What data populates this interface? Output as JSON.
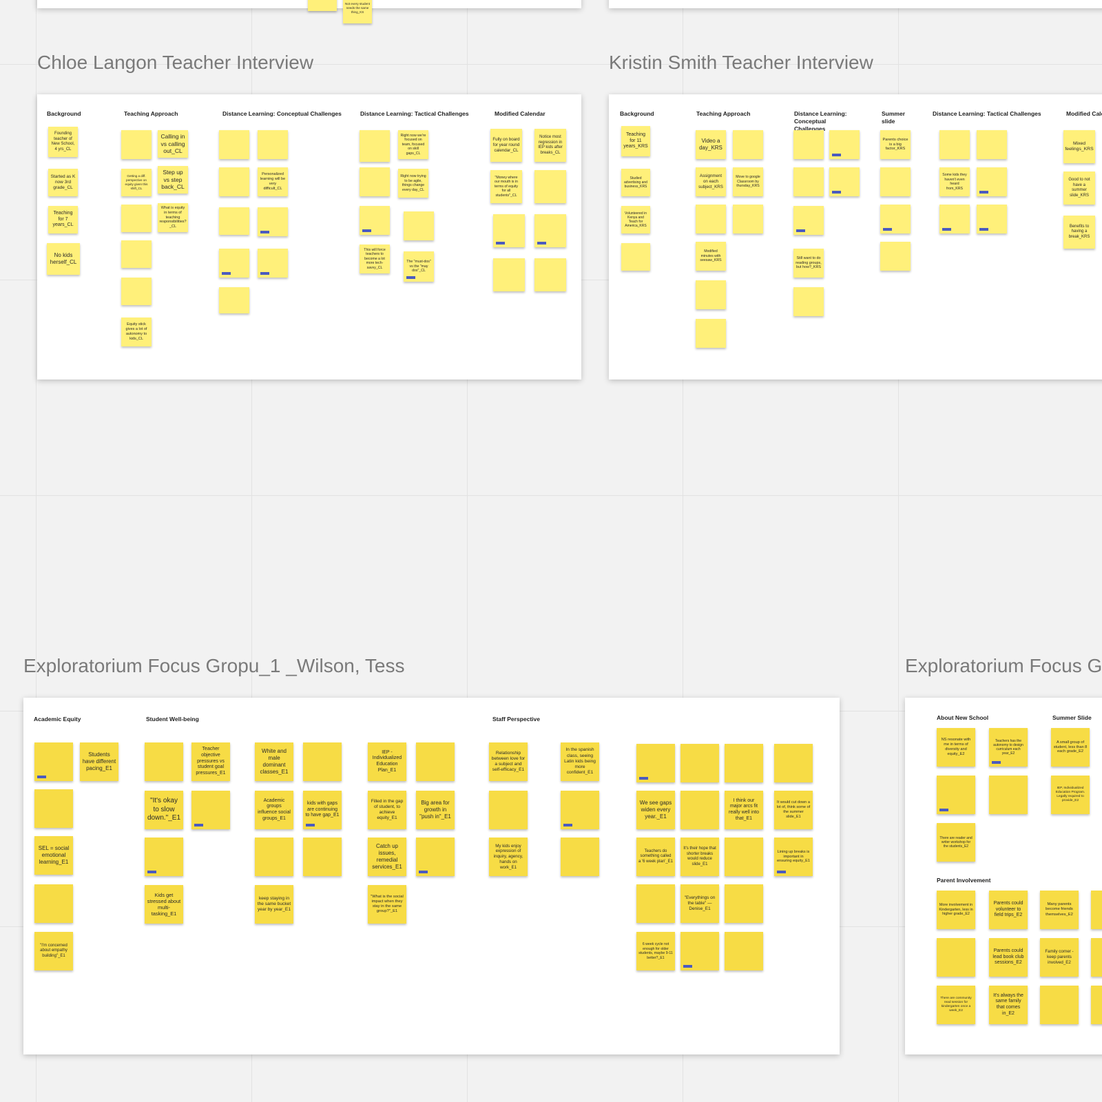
{
  "canvas": {
    "top_fragments": {
      "notes": [
        "Not every student needs the same thing_KS"
      ]
    }
  },
  "frames": {
    "chloe": {
      "title": "Chloe Langon Teacher Interview",
      "columns": [
        "Background",
        "Teaching Approach",
        "Distance Learning: Conceptual Challenges",
        "Distance Learning: Tactical Challenges",
        "Modified Calendar"
      ],
      "notes": [
        "Founding teacher of New School, 4 yrs_CL",
        "Started as K now 3rd grade_CL",
        "Teaching for 7 years_CL",
        "No kids herself_CL",
        "Calling in vs calling out_CL",
        "Getting a diff. perspective on equity given this shift_CL",
        "Step up vs step back_CL",
        "What is equity in terms of teaching responsibilities?_CL",
        "Equity stick gives a lot of autonomy to kids_CL",
        "Personalized learning will be very difficult_CL",
        "Right now we're focused on team, focused on skill gaps_CL",
        "Right now trying to be agile, things change every day_CL",
        "This will force teachers to become a lot more tech-savvy_CL",
        "The \"must-dos\" vs the \"may dos\"_CL",
        "Fully on board for year round calendar_CL",
        "Notice most regression in IEP kids after breaks_CL",
        "\"Money where our mouth is in terms of equity for all students\"_CL"
      ]
    },
    "kristin": {
      "title": "Kristin Smith Teacher Interview",
      "columns": [
        "Background",
        "Teaching Approach",
        "Distance Learning: Conceptual Challenges",
        "Summer slide",
        "Distance Learning: Tactical Challenges",
        "Modified Cale"
      ],
      "notes": [
        "Teaching for 11 years_KRS",
        "Studied advertising and business_KRS",
        "Volunteered in Kenya and Teach for America_KRS",
        "Video a day_KRS",
        "Assignment on each subject_KRS",
        "Move to google Classroom by thursday_KRS",
        "Modified minutes with seesaw_KRS",
        "Still want to do reading groups, but how?_KRS",
        "Parents choice is a big factor_KRS",
        "Some kids they haven't even heard from_KRS",
        "Mixed feelings_KRS",
        "Good to not have a summer slide_KRS",
        "Benefits to having a break_KRS"
      ]
    },
    "wilson": {
      "title": "Exploratorium Focus Gropu_1 _Wilson, Tess",
      "columns": [
        "Academic Equity",
        "Student Well-being",
        "Staff Perspective"
      ],
      "notes": [
        "Students have different pacing_E1",
        "SEL = social emotional learning_E1",
        "\"I'm concerned about empathy building\"_E1",
        "Teacher objective pressures vs student goal pressures_E1",
        "\"It's okay to slow down.\"_E1",
        "Kids get stressed about multi-tasking_E1",
        "White and male dominant classes_E1",
        "Academic groups influence social groups_E1",
        "kids with gaps are continuing to have gap_E1",
        "keep staying in the same bucket year by year_E1",
        "IEP - Individualized Education Plan_E1",
        "Filled in the gap of student, to achieve equity_E1",
        "Big area for growth in \"push in\"_E1",
        "Catch up issues, remedial services_E1",
        "\"What is the social impact when they stay in the same group?\"_E1",
        "Relationship between love for a subject and self-efficacy_E1",
        "My kids enjoy expression of inquiry, agency, hands on work_E1",
        "In the spanish class, seeing Latin kids being more confident_E1",
        "We see gaps widen every year._E1",
        "Teachers do something called a '6 week plan'_E1",
        "6 week cycle not enough for older students, maybe 9-11 better?_E1",
        "\"Everythings on the table\" — Denise_E1",
        "It's their hope that shorter breaks would reduce slide_E1",
        "I think our major arcs fit really well into that_E1",
        "It would cut down a lot of, think some of the summer slide_E1",
        "Lining up breaks is important in ensuring equity_E1"
      ]
    },
    "e2": {
      "title": "Exploratorium Focus G",
      "columns": [
        "About New School",
        "Summer Slide",
        "Parent Involvement"
      ],
      "notes": [
        "NS resonate with me in terms of diversity and equity_E2",
        "Teachers has the autonomy to design curriculum each year_E2",
        "A small group of student, less than 8 each grade_E2",
        "IEP, Individualized Education Program. Legally required to provide_E2",
        "There are reader and writer workshop for the students_E2",
        "More involvement in Kindergarten, less in higher grade_E2",
        "Parents could volunteer to field trips_E2",
        "Many parents become friends themselves_E2",
        "Parents could lead book club sessions_E2",
        "Family corner - keep parents involved_E2",
        "There are community read session for kindergarten once a week_E2",
        "It's always the same family that comes in_E2"
      ]
    }
  },
  "colors": {
    "canvas": "#f2f2f2",
    "board": "#ffffff",
    "sticky_light": "#fff07a",
    "sticky_yellow": "#f7dc45",
    "tag_blue": "#4b5bbf",
    "title_gray": "#7a7a7a"
  }
}
